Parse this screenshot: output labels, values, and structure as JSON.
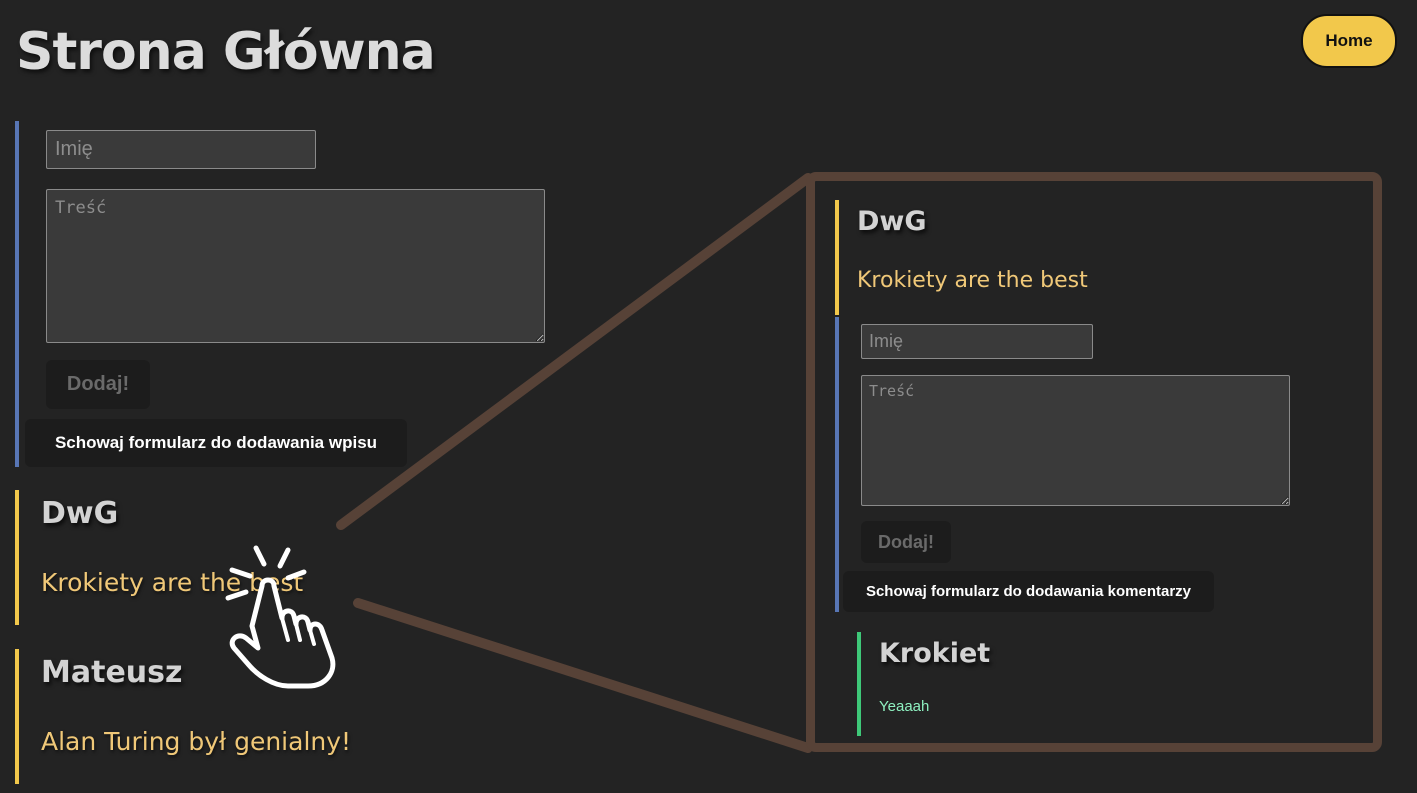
{
  "header": {
    "title": "Strona Główna",
    "home_label": "Home"
  },
  "entry_form": {
    "name_placeholder": "Imię",
    "content_placeholder": "Treść",
    "submit_label": "Dodaj!",
    "hide_label": "Schowaj formularz do dodawania wpisu"
  },
  "posts": [
    {
      "author": "DwG",
      "body": "Krokiety are the best"
    },
    {
      "author": "Mateusz",
      "body": "Alan Turing był genialny!"
    }
  ],
  "zoom": {
    "post": {
      "author": "DwG",
      "body": "Krokiety are the best"
    },
    "comment_form": {
      "name_placeholder": "Imię",
      "content_placeholder": "Treść",
      "submit_label": "Dodaj!",
      "hide_label": "Schowaj formularz do dodawania komentarzy"
    },
    "comments": [
      {
        "author": "Krokiet",
        "body": "Yeaaah"
      }
    ]
  },
  "colors": {
    "background": "#232323",
    "accent_yellow": "#f2c84b",
    "form_border_blue": "#5876b5",
    "comment_border_green": "#3ec878",
    "callout_brown": "#574237"
  },
  "icons": {
    "click_cursor": "hand-pointer-click-icon"
  }
}
